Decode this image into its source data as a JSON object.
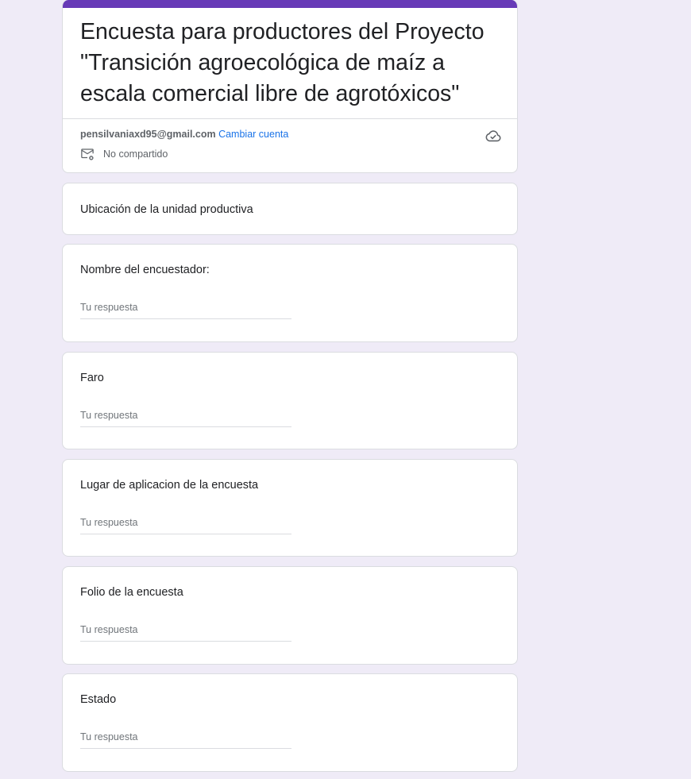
{
  "form": {
    "title": "Encuesta para productores del Proyecto \"Transición agroecológica de maíz a escala comercial libre de agrotóxicos\"",
    "accent_color": "#673ab7",
    "background_color": "#efebf7"
  },
  "account": {
    "email": "pensilvaniaxd95@gmail.com",
    "switch_label": "Cambiar cuenta",
    "share_status": "No compartido",
    "save_icon": "cloud-check-icon",
    "share_icon": "mail-blocked-icon"
  },
  "section": {
    "title": "Ubicación de la unidad productiva"
  },
  "questions": [
    {
      "label": "Nombre del encuestador:",
      "placeholder": "Tu respuesta",
      "value": ""
    },
    {
      "label": "Faro",
      "placeholder": "Tu respuesta",
      "value": ""
    },
    {
      "label": "Lugar de aplicacion de la encuesta",
      "placeholder": "Tu respuesta",
      "value": ""
    },
    {
      "label": "Folio de la encuesta",
      "placeholder": "Tu respuesta",
      "value": ""
    },
    {
      "label": "Estado",
      "placeholder": "Tu respuesta",
      "value": ""
    }
  ]
}
